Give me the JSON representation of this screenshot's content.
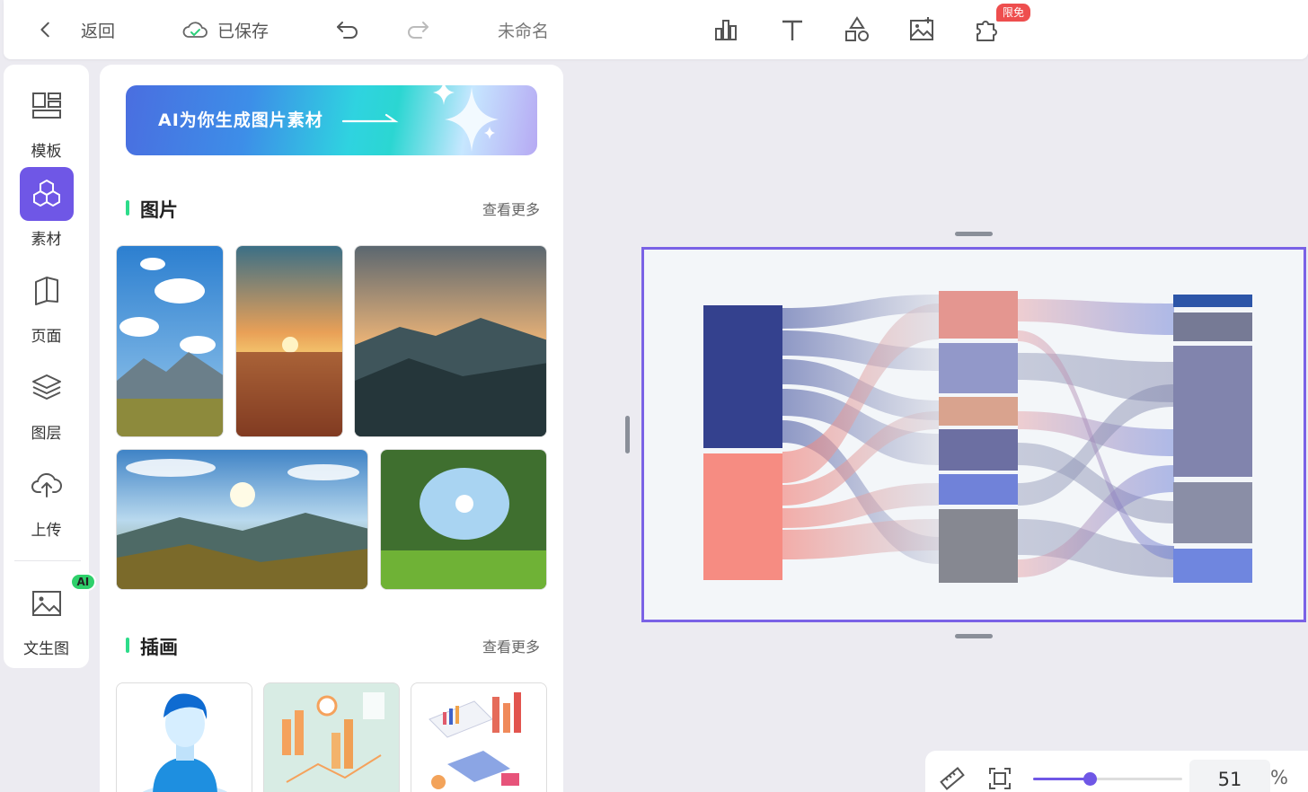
{
  "topbar": {
    "back_label": "返回",
    "save_status": "已保存",
    "doc_title": "未命名",
    "free_badge": "限免"
  },
  "leftnav": {
    "items": [
      {
        "label": "模板",
        "icon": "template-icon"
      },
      {
        "label": "素材",
        "icon": "material-icon"
      },
      {
        "label": "页面",
        "icon": "page-icon"
      },
      {
        "label": "图层",
        "icon": "layers-icon"
      },
      {
        "label": "上传",
        "icon": "upload-icon"
      },
      {
        "label": "文生图",
        "icon": "text-to-image-icon"
      }
    ],
    "ai_badge": "AI",
    "accent": "#6f57e6"
  },
  "panel": {
    "banner_text": "AI为你生成图片素材",
    "sections": [
      {
        "title": "图片",
        "more": "查看更多"
      },
      {
        "title": "插画",
        "more": "查看更多"
      }
    ]
  },
  "zoom": {
    "value": "51",
    "unit": "%",
    "fraction": 0.4
  }
}
